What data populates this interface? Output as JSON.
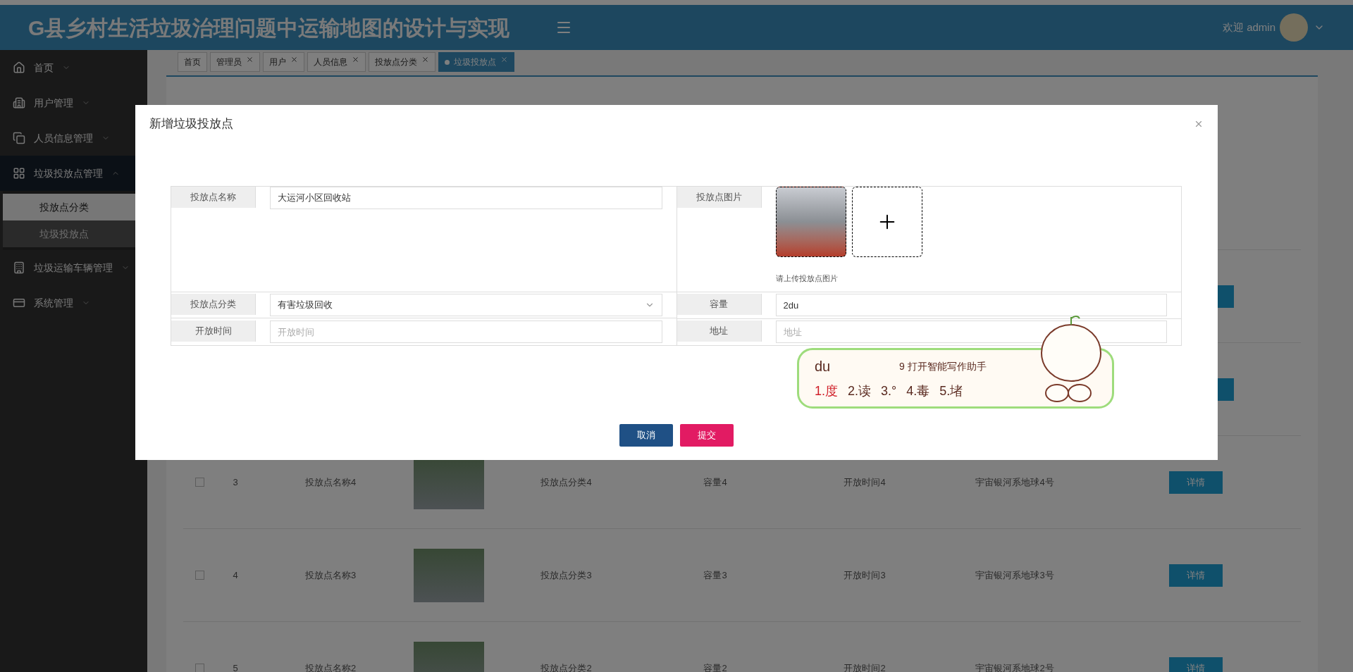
{
  "header": {
    "title": "G县乡村生活垃圾治理问题中运输地图的设计与实现",
    "welcome": "欢迎 admin"
  },
  "sidebar": {
    "items": [
      {
        "label": "首页",
        "expanded": false
      },
      {
        "label": "用户管理",
        "expanded": false
      },
      {
        "label": "人员信息管理",
        "expanded": false
      },
      {
        "label": "垃圾投放点管理",
        "expanded": true,
        "children": [
          {
            "label": "投放点分类",
            "selected": true
          },
          {
            "label": "垃圾投放点",
            "selected": false
          }
        ]
      },
      {
        "label": "垃圾运输车辆管理",
        "expanded": false
      },
      {
        "label": "系统管理",
        "expanded": false
      }
    ]
  },
  "tabs": [
    {
      "label": "首页",
      "closable": false,
      "selected": false
    },
    {
      "label": "管理员",
      "closable": true,
      "selected": false
    },
    {
      "label": "用户",
      "closable": true,
      "selected": false
    },
    {
      "label": "人员信息",
      "closable": true,
      "selected": false
    },
    {
      "label": "投放点分类",
      "closable": true,
      "selected": false
    },
    {
      "label": "垃圾投放点",
      "closable": true,
      "selected": true
    }
  ],
  "table": {
    "rows": [
      {
        "checked": false,
        "index": "3",
        "name": "投放点名称4",
        "category": "投放点分类4",
        "capacity": "容量4",
        "open_time": "开放时间4",
        "address": "宇宙银河系地球4号",
        "action": "详情"
      },
      {
        "checked": false,
        "index": "4",
        "name": "投放点名称3",
        "category": "投放点分类3",
        "capacity": "容量3",
        "open_time": "开放时间3",
        "address": "宇宙银河系地球3号",
        "action": "详情"
      },
      {
        "checked": false,
        "index": "5",
        "name": "投放点名称2",
        "category": "投放点分类2",
        "capacity": "容量2",
        "open_time": "开放时间2",
        "address": "宇宙银河系地球2号",
        "action": "详情"
      }
    ]
  },
  "dialog": {
    "title": "新增垃圾投放点",
    "fields": [
      {
        "kind": "text",
        "label": "投放点名称",
        "value": "大运河小区回收站"
      },
      {
        "kind": "image",
        "label": "投放点图片",
        "hint": "请上传投放点图片"
      },
      {
        "kind": "select",
        "label": "投放点分类",
        "value": "有害垃圾回收"
      },
      {
        "kind": "text",
        "label": "容量",
        "value": "2du"
      },
      {
        "kind": "text",
        "label": "开放时间",
        "placeholder": "开放时间"
      },
      {
        "kind": "text",
        "label": "地址",
        "placeholder": "地址"
      }
    ],
    "buttons": [
      {
        "label": "取消",
        "kind": "secondary"
      },
      {
        "label": "提交",
        "kind": "primary"
      }
    ]
  },
  "ime": {
    "input": "du",
    "assistant": "9 打开智能写作助手",
    "candidates": [
      {
        "label": "1.度",
        "selected": true
      },
      {
        "label": "2.读",
        "selected": false
      },
      {
        "label": "3.°",
        "selected": false
      },
      {
        "label": "4.毒",
        "selected": false
      },
      {
        "label": "5.堵",
        "selected": false
      }
    ]
  }
}
